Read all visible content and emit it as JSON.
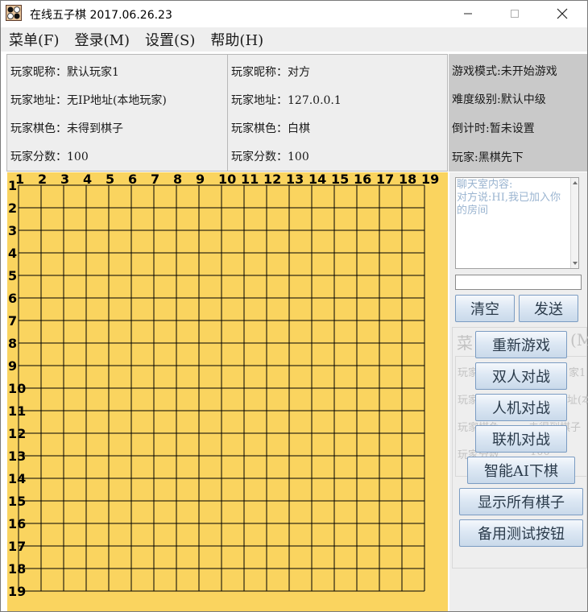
{
  "window": {
    "title": "在线五子棋  2017.06.26.23"
  },
  "menu": {
    "items": [
      "菜单(F)",
      "登录(M)",
      "设置(S)",
      "帮助(H)"
    ]
  },
  "player1": {
    "nickname": "玩家昵称：默认玩家1",
    "address": "玩家地址：无IP地址(本地玩家)",
    "color": "玩家棋色：未得到棋子",
    "score": "玩家分数：100"
  },
  "player2": {
    "nickname": "玩家昵称：对方",
    "address": "玩家地址：127.0.0.1",
    "color": "玩家棋色：白棋",
    "score": "玩家分数：100"
  },
  "status": {
    "mode": "游戏模式:未开始游戏",
    "difficulty": "难度级别:默认中级",
    "countdown": "倒计时:暂未设置",
    "turn": "玩家:黑棋先下"
  },
  "board": {
    "size": 19,
    "column_labels": [
      "1",
      "2",
      "3",
      "4",
      "5",
      "6",
      "7",
      "8",
      "9",
      "10",
      "11",
      "12",
      "13",
      "14",
      "15",
      "16",
      "17",
      "18",
      "19"
    ],
    "row_labels": [
      "1",
      "2",
      "3",
      "4",
      "5",
      "6",
      "7",
      "8",
      "9",
      "10",
      "11",
      "12",
      "13",
      "14",
      "15",
      "16",
      "17",
      "18",
      "19"
    ],
    "background": "#fad45f",
    "line_color": "#000000"
  },
  "chat": {
    "header": "聊天室内容:",
    "message": "对方说:HI,我已加入你的房间",
    "input_value": ""
  },
  "buttons": {
    "clear": "清空",
    "send": "发送",
    "restart": "重新游戏",
    "pvp": "双人对战",
    "pve": "人机对战",
    "online": "联机对战",
    "ai_move": "智能AI下棋",
    "show_all": "显示所有棋子",
    "test": "备用测试按钮"
  },
  "ghost": {
    "menu_a": "菜",
    "menu_b": "(M",
    "line1": "玩家",
    "line1_tail": "家1",
    "line2": "玩家",
    "line2_tail": "址(本",
    "line3": "玩家棋色",
    "line3_tail": "未得到棋子",
    "line4": "玩家分数",
    "line4_tail": "100"
  },
  "colors": {
    "accent_button_border": "#7b9cc2",
    "chat_text": "#9ab4d0",
    "status_bg": "#c9c9c9"
  }
}
